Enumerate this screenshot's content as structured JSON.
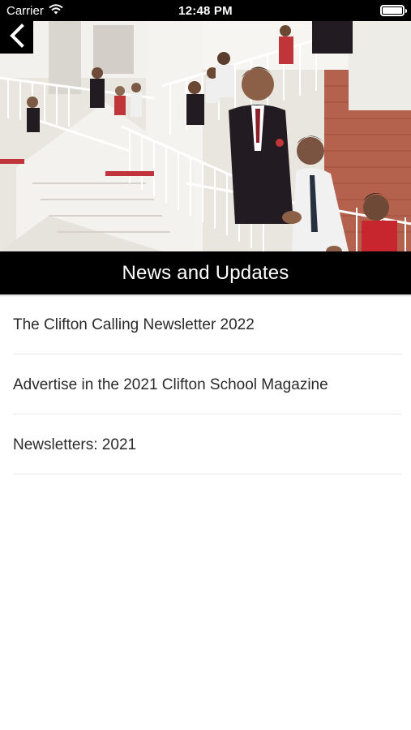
{
  "status_bar": {
    "carrier": "Carrier",
    "time": "12:48 PM",
    "battery_level": 1.0
  },
  "nav": {
    "back_icon": "chevron-left-icon"
  },
  "hero": {
    "image_icon": "school-students-on-staircase-photo"
  },
  "header": {
    "title": "News and Updates"
  },
  "news": {
    "items": [
      {
        "label": "The Clifton Calling Newsletter 2022"
      },
      {
        "label": "Advertise in the 2021 Clifton School Magazine"
      },
      {
        "label": "Newsletters: 2021"
      }
    ]
  },
  "colors": {
    "bar": "#000000",
    "text": "#2a2a2a",
    "divider": "#e6e6e6",
    "blazer": "#231b22",
    "brick": "#b4624e"
  }
}
